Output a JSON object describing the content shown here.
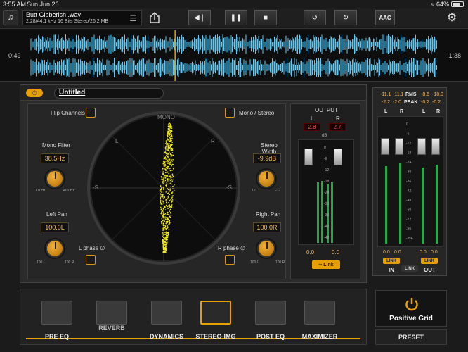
{
  "status": {
    "time": "3:55 AM",
    "date": "Sun Jun 26",
    "battery": "64%"
  },
  "toolbar": {
    "file_name": "Butt Gibberish .wav",
    "file_meta": "2:28/44.1 kHz 16 Bits Stereo/26.2 MB",
    "format_button": "AAC"
  },
  "waveform": {
    "elapsed": "0:49",
    "remaining": "- 1:38",
    "progress": 0.355,
    "accent": "#5fc8f2"
  },
  "panel": {
    "preset_name": "Untitled",
    "flip_channels": "Flip Channels",
    "mono_stereo": "Mono / Stereo",
    "mono_filter": {
      "label": "Mono Filter",
      "value": "38.5Hz",
      "min": "1.0 Hz",
      "max": "400 Hz"
    },
    "stereo_width": {
      "label": "Stereo Width",
      "value": "-9.9dB",
      "min": "12",
      "max": "-12"
    },
    "left_pan": {
      "label": "Left Pan",
      "value": "100.0L",
      "min": "100 L",
      "max": "100 R"
    },
    "right_pan": {
      "label": "Right Pan",
      "value": "100.0R",
      "min": "100 L",
      "max": "100 R"
    },
    "l_phase": "L phase ∅",
    "r_phase": "R phase ∅",
    "scope": {
      "mono": "MONO",
      "l": "L",
      "r": "R",
      "neg_s_left": "-S",
      "neg_s_right": "-S"
    }
  },
  "output": {
    "title": "OUTPUT",
    "l": "L",
    "r": "R",
    "l_peak": "2.8",
    "r_peak": "2.7",
    "db": "dB",
    "scale": [
      "0",
      "-6",
      "-12",
      "-18",
      "-24",
      "-30",
      "-36",
      "-42",
      "-48"
    ],
    "l_val": "0.0",
    "r_val": "0.0",
    "link": "Link"
  },
  "meters": {
    "rms_l": "-11.1",
    "rms_r": "-11.1",
    "rms": "RMS",
    "rms_out_l": "-8.6",
    "rms_out_r": "-18.0",
    "peak_l": "-2.2",
    "peak_r": "-2.0",
    "peak": "PEAK",
    "peak_out_l": "-0.2",
    "peak_out_r": "-0.2",
    "in_l": "L",
    "in_r": "R",
    "out_l": "L",
    "out_r": "R",
    "scale": [
      "0",
      "-6",
      "-12",
      "-18",
      "-24",
      "-30",
      "-36",
      "-42",
      "-48",
      "-60",
      "-72",
      "-96",
      "-INF"
    ],
    "in_val_l": "0.0",
    "in_val_r": "0.0",
    "out_val_l": "0.0",
    "out_val_r": "0.0",
    "link": "LINK",
    "in": "IN",
    "out": "OUT"
  },
  "chain": {
    "modules": [
      "PRE EQ",
      "REVERB",
      "DYNAMICS",
      "STEREO-IMG",
      "POST EQ",
      "MAXIMIZER"
    ],
    "active_index": 3
  },
  "brand": {
    "name": "Positive Grid",
    "preset_button": "PRESET",
    "accent": "#e6a000"
  }
}
